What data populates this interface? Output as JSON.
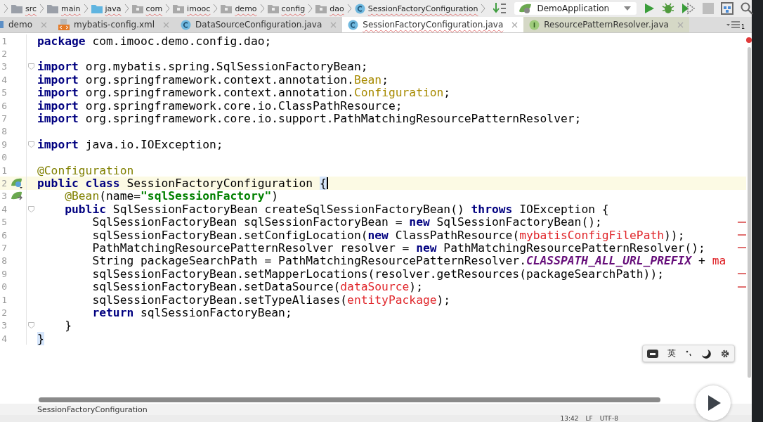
{
  "breadcrumbs": [
    {
      "label": "src",
      "kind": "folder"
    },
    {
      "label": "main",
      "kind": "folder"
    },
    {
      "label": "java",
      "kind": "source-folder"
    },
    {
      "label": "com",
      "kind": "package"
    },
    {
      "label": "imooc",
      "kind": "package"
    },
    {
      "label": "demo",
      "kind": "package"
    },
    {
      "label": "config",
      "kind": "package"
    },
    {
      "label": "dao",
      "kind": "package"
    },
    {
      "label": "SessionFactoryConfiguration",
      "kind": "class"
    }
  ],
  "run_config": {
    "label": "DemoApplication"
  },
  "toolbar": [
    {
      "kind": "sort",
      "disabled": false
    },
    {
      "kind": "run",
      "disabled": false
    },
    {
      "kind": "debug",
      "disabled": false
    },
    {
      "kind": "coverage",
      "disabled": false
    },
    {
      "kind": "stop",
      "disabled": true
    },
    {
      "kind": "structure",
      "disabled": false
    },
    {
      "kind": "search",
      "disabled": false
    }
  ],
  "tabs": [
    {
      "label": "demo",
      "kind": "module",
      "selected": false
    },
    {
      "label": "mybatis-config.xml",
      "kind": "xml",
      "selected": false
    },
    {
      "label": "DataSourceConfiguration.java",
      "kind": "class",
      "selected": false
    },
    {
      "label": "SessionFactoryConfiguration.java",
      "kind": "class",
      "selected": true
    },
    {
      "label": "ResourcePatternResolver.java",
      "kind": "interface",
      "selected": false
    }
  ],
  "tab_overflow_count": "1",
  "editor": {
    "error_indicator": true,
    "lines": [
      {
        "number": "1",
        "tokens": [
          {
            "text": "package",
            "kind": "keyword"
          },
          {
            "text": " com.imooc.demo.config.dao;",
            "kind": "plain"
          }
        ]
      },
      {
        "number": "2"
      },
      {
        "number": "3",
        "fold": true,
        "tokens": [
          {
            "text": "import",
            "kind": "keyword"
          },
          {
            "text": " org.mybatis.spring.SqlSessionFactoryBean;",
            "kind": "plain"
          }
        ]
      },
      {
        "number": "4",
        "tokens": [
          {
            "text": "import",
            "kind": "keyword"
          },
          {
            "text": " org.springframework.context.annotation.",
            "kind": "plain"
          },
          {
            "text": "Bean",
            "kind": "unused"
          },
          {
            "text": ";",
            "kind": "plain"
          }
        ]
      },
      {
        "number": "5",
        "tokens": [
          {
            "text": "import",
            "kind": "keyword"
          },
          {
            "text": " org.springframework.context.annotation.",
            "kind": "plain"
          },
          {
            "text": "Configuration",
            "kind": "unused"
          },
          {
            "text": ";",
            "kind": "plain"
          }
        ]
      },
      {
        "number": "6",
        "tokens": [
          {
            "text": "import",
            "kind": "keyword"
          },
          {
            "text": " org.springframework.core.io.ClassPathResource;",
            "kind": "plain"
          }
        ]
      },
      {
        "number": "7",
        "tokens": [
          {
            "text": "import",
            "kind": "keyword"
          },
          {
            "text": " org.springframework.core.io.support.PathMatchingResourcePatternResolver;",
            "kind": "plain"
          }
        ]
      },
      {
        "number": "8"
      },
      {
        "number": "9",
        "fold": true,
        "tokens": [
          {
            "text": "import",
            "kind": "keyword"
          },
          {
            "text": " java.io.IOException;",
            "kind": "plain"
          }
        ]
      },
      {
        "number": "0"
      },
      {
        "number": "1",
        "tokens": [
          {
            "text": "@Configuration",
            "kind": "annotation"
          }
        ]
      },
      {
        "number": "2",
        "current": true,
        "gutter_icon": {
          "kind": "bean-class"
        },
        "tokens": [
          {
            "text": "public class",
            "kind": "keyword"
          },
          {
            "text": " SessionFactoryConfiguration ",
            "kind": "plain"
          },
          {
            "text": "{",
            "kind": "brace"
          }
        ]
      },
      {
        "number": "3",
        "gutter_icon": {
          "kind": "bean-method"
        },
        "tokens": [
          {
            "text": "    @Bean",
            "kind": "annotation"
          },
          {
            "text": "(name=",
            "kind": "plain"
          },
          {
            "text": "\"sqlSessionFactory\"",
            "kind": "string"
          },
          {
            "text": ")",
            "kind": "plain"
          }
        ]
      },
      {
        "number": "4",
        "fold": true,
        "tokens": [
          {
            "text": "    public",
            "kind": "keyword"
          },
          {
            "text": " SqlSessionFactoryBean createSqlSessionFactoryBean() ",
            "kind": "plain"
          },
          {
            "text": "throws",
            "kind": "keyword"
          },
          {
            "text": " IOException {",
            "kind": "plain"
          }
        ]
      },
      {
        "number": "5",
        "stripe": true,
        "tokens": [
          {
            "text": "        SqlSessionFactoryBean sqlSessionFactoryBean = ",
            "kind": "plain"
          },
          {
            "text": "new",
            "kind": "keyword"
          },
          {
            "text": " SqlSessionFactoryBean();",
            "kind": "plain"
          }
        ]
      },
      {
        "number": "6",
        "stripe": true,
        "tokens": [
          {
            "text": "        sqlSessionFactoryBean.setConfigLocation(",
            "kind": "plain"
          },
          {
            "text": "new",
            "kind": "keyword"
          },
          {
            "text": " ClassPathResource(",
            "kind": "plain"
          },
          {
            "text": "mybatisConfigFilePath",
            "kind": "unresolved"
          },
          {
            "text": "));",
            "kind": "plain"
          }
        ]
      },
      {
        "number": "7",
        "stripe": true,
        "tokens": [
          {
            "text": "        PathMatchingResourcePatternResolver resolver = ",
            "kind": "plain"
          },
          {
            "text": "new",
            "kind": "keyword"
          },
          {
            "text": " PathMatchingResourcePatternResolver();",
            "kind": "plain"
          }
        ]
      },
      {
        "number": "8",
        "tokens": [
          {
            "text": "        String packageSearchPath = PathMatchingResourcePatternResolver.",
            "kind": "plain"
          },
          {
            "text": "CLASSPATH_ALL_URL_PREFIX",
            "kind": "constant"
          },
          {
            "text": " + ",
            "kind": "plain"
          },
          {
            "text": "ma",
            "kind": "unresolved"
          }
        ]
      },
      {
        "number": "9",
        "stripe": true,
        "tokens": [
          {
            "text": "        sqlSessionFactoryBean.setMapperLocations(resolver.getResources(packageSearchPath));",
            "kind": "plain"
          }
        ]
      },
      {
        "number": "0",
        "stripe": true,
        "tokens": [
          {
            "text": "        sqlSessionFactoryBean.setDataSource(",
            "kind": "plain"
          },
          {
            "text": "dataSource",
            "kind": "unresolved"
          },
          {
            "text": ");",
            "kind": "plain"
          }
        ]
      },
      {
        "number": "1",
        "tokens": [
          {
            "text": "        sqlSessionFactoryBean.setTypeAliases(",
            "kind": "plain"
          },
          {
            "text": "entityPackage",
            "kind": "unresolved"
          },
          {
            "text": ");",
            "kind": "plain"
          }
        ]
      },
      {
        "number": "2",
        "tokens": [
          {
            "text": "        return",
            "kind": "keyword"
          },
          {
            "text": " sqlSessionFactoryBean;",
            "kind": "plain"
          }
        ]
      },
      {
        "number": "3",
        "fold": true,
        "tokens": [
          {
            "text": "    }",
            "kind": "plain"
          }
        ]
      },
      {
        "number": "4",
        "tokens": [
          {
            "text": "}",
            "kind": "brace"
          }
        ]
      }
    ]
  },
  "ime_toolbar": {
    "language": "英"
  },
  "status_text": "SessionFactoryConfiguration",
  "status_bar": [
    "13:42",
    "LF",
    "UTF-8"
  ]
}
